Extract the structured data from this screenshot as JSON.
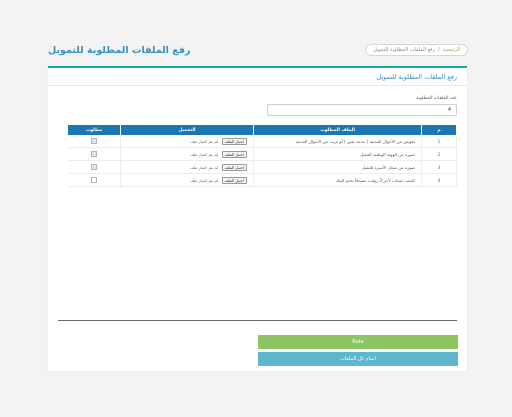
{
  "header": {
    "title": "رفع الملفات المطلوبة للتمويل",
    "breadcrumb": {
      "home": "الرئيسية",
      "separator": "/",
      "current": "رفع الملفات المطلوبة للتمويل"
    }
  },
  "card": {
    "title": "رفع الملفات المطلوبة للتمويل",
    "count_label": "عدد الملفات المطلوبة",
    "count_value": "4"
  },
  "table": {
    "headers": {
      "num": "م",
      "file": "الملف المطلوب",
      "upload": "التحميل",
      "required": "مطلوب"
    },
    "rows": [
      {
        "num": "1",
        "file": "تفويض من الأحوال المدنية ( خدمة يقين ) أو برنت من الأحوال المدنية",
        "btn": "اختيار الملف",
        "status": "لم يتم اختيار ملف",
        "required": true
      },
      {
        "num": "2",
        "file": "صورة من الهوية الوطنية للعميل",
        "btn": "اختيار الملف",
        "status": "لم يتم اختيار ملف",
        "required": true
      },
      {
        "num": "3",
        "file": "صورة من سجل الأسرة للعميل",
        "btn": "اختيار الملف",
        "status": "لم يتم اختيار ملف",
        "required": true
      },
      {
        "num": "4",
        "file": "كشف حساب لآخر 3 رواتب مصدقاً بختم البنك",
        "btn": "اختيار الملف",
        "status": "لم يتم اختيار ملف",
        "required": false
      }
    ]
  },
  "actions": {
    "done": "Rate",
    "complete": "اتمام كل الملفات"
  },
  "colors": {
    "accent": "#3b8fc4",
    "table_header": "#1a77b0",
    "card_top_border": "#14a9a0",
    "done_button": "#8cc561",
    "complete_button": "#5fb6cf"
  }
}
